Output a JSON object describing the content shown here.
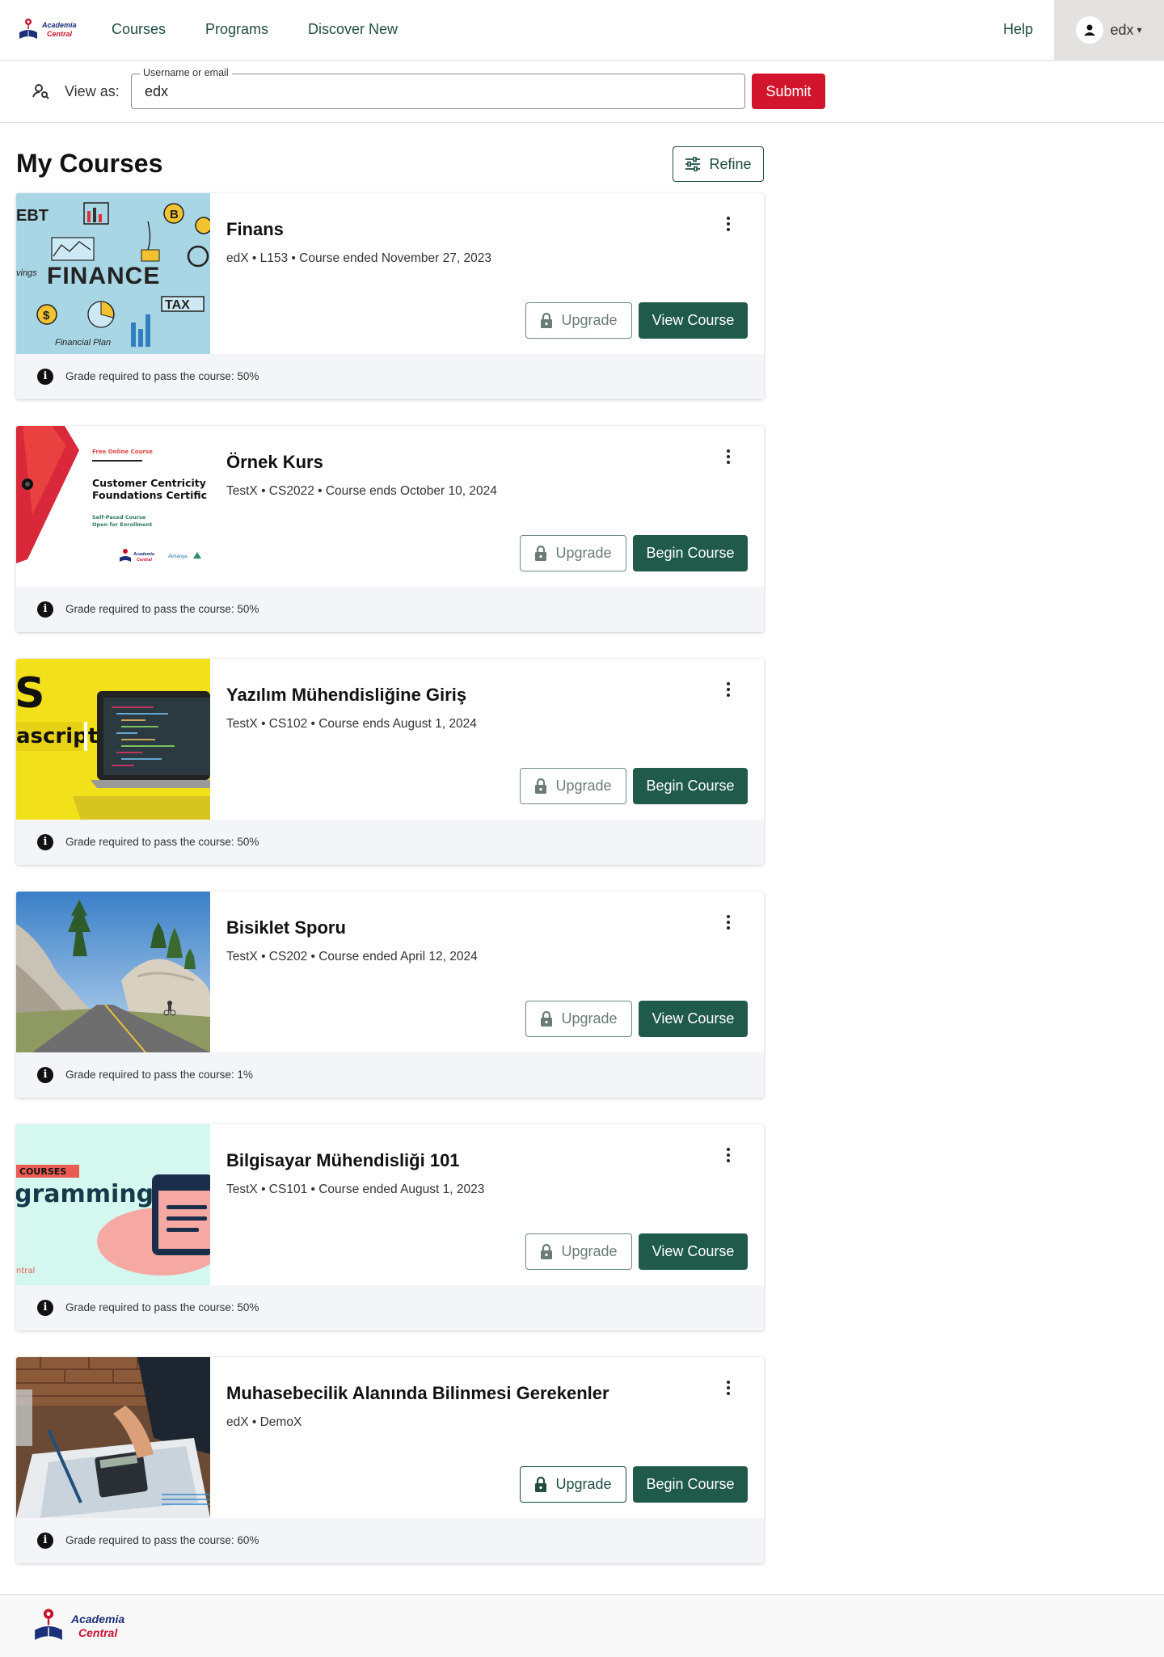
{
  "brand": {
    "line1": "Academia",
    "line2": "Central"
  },
  "nav": {
    "courses": "Courses",
    "programs": "Programs",
    "discover": "Discover New",
    "help": "Help",
    "username": "edx"
  },
  "view_as": {
    "label": "View as:",
    "field_label": "Username or email",
    "value": "edx",
    "submit": "Submit"
  },
  "page": {
    "title": "My Courses",
    "refine": "Refine"
  },
  "courses": [
    {
      "title": "Finans",
      "meta": "edX • L153 • Course ended November 27, 2023",
      "upgrade": "Upgrade",
      "action": "View Course",
      "grade": "Grade required to pass the course: 50%",
      "image": "finance-illustration"
    },
    {
      "title": "Örnek Kurs",
      "meta": "TestX • CS2022 • Course ends October 10, 2024",
      "upgrade": "Upgrade",
      "action": "Begin Course",
      "grade": "Grade required to pass the course: 50%",
      "image": "customer-centricity-banner",
      "image_text": {
        "tag": "Free Online Course",
        "heading1": "Customer Centricity",
        "heading2": "Foundations Certific",
        "sub1": "Self-Paced Course",
        "sub2": "Open for Enrollment",
        "logo2": "Almanya"
      }
    },
    {
      "title": "Yazılım Mühendisliğine Giriş",
      "meta": "TestX • CS102 • Course ends August 1, 2024",
      "upgrade": "Upgrade",
      "action": "Begin Course",
      "grade": "Grade required to pass the course: 50%",
      "image": "javascript-laptop",
      "image_text": {
        "big": "S",
        "word": "ascript"
      }
    },
    {
      "title": "Bisiklet Sporu",
      "meta": "TestX • CS202 • Course ended April 12, 2024",
      "upgrade": "Upgrade",
      "action": "View Course",
      "grade": "Grade required to pass the course: 1%",
      "image": "cycling-road-photo"
    },
    {
      "title": "Bilgisayar Mühendisliği 101",
      "meta": "TestX • CS101 • Course ended August 1, 2023",
      "upgrade": "Upgrade",
      "action": "View Course",
      "grade": "Grade required to pass the course: 50%",
      "image": "programming-courses-banner",
      "image_text": {
        "tag": "COURSES",
        "word": "gramming",
        "corner": "ntral"
      }
    },
    {
      "title": "Muhasebecilik Alanında Bilinmesi Gerekenler",
      "meta": "edX • DemoX",
      "upgrade": "Upgrade",
      "action": "Begin Course",
      "grade": "Grade required to pass the course: 60%",
      "image": "accounting-calculator-photo"
    }
  ],
  "finance_image_text": {
    "ebt": "EBT",
    "finance": "FINANCE",
    "tax": "TAX",
    "plan": "Financial Plan",
    "vings": "vings"
  },
  "colors": {
    "brand_green": "#1f5a4a",
    "submit_red": "#d2142d",
    "link_green": "#1f4d3f"
  }
}
